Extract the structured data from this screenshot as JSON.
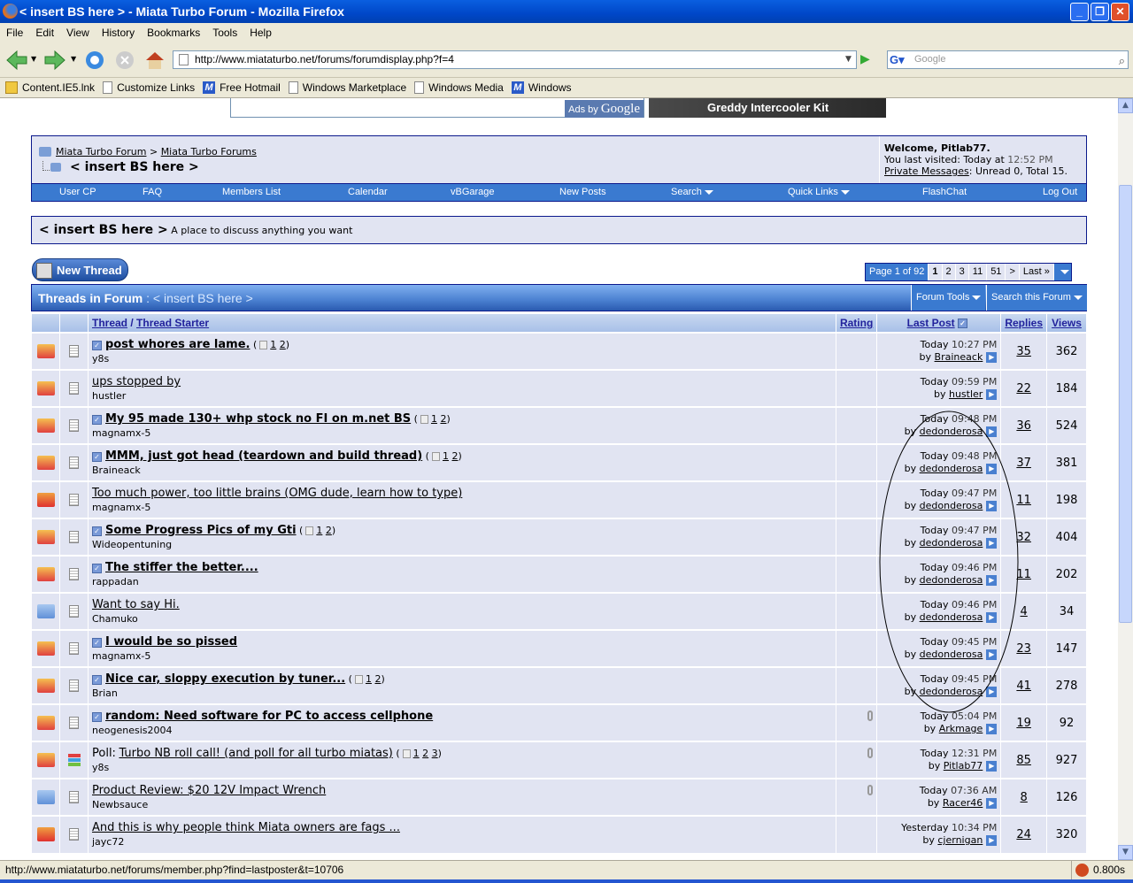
{
  "window": {
    "title": "< insert BS here > - Miata Turbo Forum - Mozilla Firefox",
    "buttons": [
      "_",
      "❐",
      "✕"
    ]
  },
  "menu": [
    "File",
    "Edit",
    "View",
    "History",
    "Bookmarks",
    "Tools",
    "Help"
  ],
  "toolbar": {
    "url": "http://www.miataturbo.net/forums/forumdisplay.php?f=4",
    "search_placeholder": "Google"
  },
  "bookmarks": [
    {
      "label": "Content.IE5.lnk",
      "icon": "folder"
    },
    {
      "label": "Customize Links",
      "icon": "page"
    },
    {
      "label": "Free Hotmail",
      "icon": "msn"
    },
    {
      "label": "Windows Marketplace",
      "icon": "page"
    },
    {
      "label": "Windows Media",
      "icon": "page"
    },
    {
      "label": "Windows",
      "icon": "msn"
    }
  ],
  "ads": {
    "google": "Ads by",
    "google_brand": "Google",
    "banner": "Greddy Intercooler Kit"
  },
  "header": {
    "crumb1": "Miata Turbo Forum",
    "sep": ">",
    "crumb2": "Miata Turbo Forums",
    "current": "< insert BS here >",
    "welcome": "Welcome, Pitlab77.",
    "last_visited_label": "You last visited: Today at",
    "last_visited_time": "12:52 PM",
    "pm_label": "Private Messages",
    "pm_text": ": Unread 0, Total 15."
  },
  "nav": [
    "User CP",
    "FAQ",
    "Members List",
    "Calendar",
    "vBGarage",
    "New Posts",
    "Search",
    "Quick Links",
    "FlashChat",
    "Log Out"
  ],
  "forum": {
    "name": "< insert BS here >",
    "description": "A place to discuss anything you want"
  },
  "new_thread": "New Thread",
  "pager": {
    "label": "Page 1 of 92",
    "pages": [
      "1",
      "2",
      "3",
      "11",
      "51",
      ">",
      "Last »"
    ]
  },
  "threadlist": {
    "heading": "Threads in Forum",
    "heading_sep": ":",
    "heading_forum": "< insert BS here >",
    "forum_tools": "Forum Tools",
    "search_forum": "Search this Forum",
    "cols": {
      "thread": "Thread",
      "slash": "/",
      "starter": "Thread Starter",
      "rating": "Rating",
      "last_post": "Last Post",
      "replies": "Replies",
      "views": "Views"
    },
    "rows": [
      {
        "title": "post whores are lame.",
        "bold": true,
        "pages": [
          "1",
          "2"
        ],
        "starter": "y8s",
        "day": "Today",
        "time": "10:27 PM",
        "by": "Braineack",
        "replies": "35",
        "views": "362",
        "icon": "hot"
      },
      {
        "title": "ups stopped by",
        "bold": false,
        "pages": [],
        "starter": "hustler",
        "day": "Today",
        "time": "09:59 PM",
        "by": "hustler",
        "replies": "22",
        "views": "184",
        "icon": "hot-dot"
      },
      {
        "title": "My 95 made 130+ whp stock no FI on m.net BS",
        "bold": true,
        "pages": [
          "1",
          "2"
        ],
        "starter": "magnamx-5",
        "day": "Today",
        "time": "09:48 PM",
        "by": "dedonderosa",
        "replies": "36",
        "views": "524",
        "icon": "hot-dot"
      },
      {
        "title": "MMM, just got head (teardown and build thread)",
        "bold": true,
        "pages": [
          "1",
          "2"
        ],
        "starter": "Braineack",
        "day": "Today",
        "time": "09:48 PM",
        "by": "dedonderosa",
        "replies": "37",
        "views": "381",
        "icon": "hot"
      },
      {
        "title": "Too much power, too little brains (OMG dude, learn how to type)",
        "bold": false,
        "pages": [],
        "starter": "magnamx-5",
        "day": "Today",
        "time": "09:47 PM",
        "by": "dedonderosa",
        "replies": "11",
        "views": "198",
        "icon": "new"
      },
      {
        "title": "Some Progress Pics of my Gti",
        "bold": true,
        "pages": [
          "1",
          "2"
        ],
        "starter": "Wideopentuning",
        "day": "Today",
        "time": "09:47 PM",
        "by": "dedonderosa",
        "replies": "32",
        "views": "404",
        "icon": "hot-dot"
      },
      {
        "title": "The stiffer the better....",
        "bold": true,
        "pages": [],
        "starter": "rappadan",
        "day": "Today",
        "time": "09:46 PM",
        "by": "dedonderosa",
        "replies": "11",
        "views": "202",
        "icon": "hot"
      },
      {
        "title": "Want to say Hi.",
        "bold": false,
        "pages": [],
        "starter": "Chamuko",
        "day": "Today",
        "time": "09:46 PM",
        "by": "dedonderosa",
        "replies": "4",
        "views": "34",
        "icon": "old-dot"
      },
      {
        "title": "I would be so pissed",
        "bold": true,
        "pages": [],
        "starter": "magnamx-5",
        "day": "Today",
        "time": "09:45 PM",
        "by": "dedonderosa",
        "replies": "23",
        "views": "147",
        "icon": "hot-dot"
      },
      {
        "title": "Nice car, sloppy execution by tuner...",
        "bold": true,
        "pages": [
          "1",
          "2"
        ],
        "starter": "Brian",
        "day": "Today",
        "time": "09:45 PM",
        "by": "dedonderosa",
        "replies": "41",
        "views": "278",
        "icon": "hot"
      },
      {
        "title": "random: Need software for PC to access cellphone",
        "bold": true,
        "pages": [],
        "starter": "neogenesis2004",
        "day": "Today",
        "time": "05:04 PM",
        "by": "Arkmage",
        "replies": "19",
        "views": "92",
        "icon": "hot-dot",
        "attach": true
      },
      {
        "title": "Turbo NB roll call! (and poll for all turbo miatas)",
        "prefix": "Poll:",
        "bold": false,
        "pages": [
          "1",
          "2",
          "3"
        ],
        "starter": "y8s",
        "day": "Today",
        "time": "12:31 PM",
        "by": "Pitlab77",
        "replies": "85",
        "views": "927",
        "icon": "hot-dot",
        "attach": true,
        "poll": true
      },
      {
        "title": "Product Review: $20 12V Impact Wrench",
        "bold": false,
        "pages": [],
        "starter": "Newbsauce",
        "day": "Today",
        "time": "07:36 AM",
        "by": "Racer46",
        "replies": "8",
        "views": "126",
        "icon": "old",
        "attach": true
      },
      {
        "title": "And this is why people think Miata owners are fags ...",
        "bold": false,
        "pages": [],
        "starter": "jayc72",
        "day": "Yesterday",
        "time": "10:34 PM",
        "by": "cjernigan",
        "replies": "24",
        "views": "320",
        "icon": "new"
      }
    ]
  },
  "by_label": "by",
  "status": {
    "text": "http://www.miataturbo.net/forums/member.php?find=lastposter&t=10706",
    "timing": "0.800s"
  },
  "colors": {
    "nav_blue": "#3a7ad0",
    "panel": "#e1e4f2",
    "border": "#0b198c",
    "titlebar": "#0047c8"
  }
}
